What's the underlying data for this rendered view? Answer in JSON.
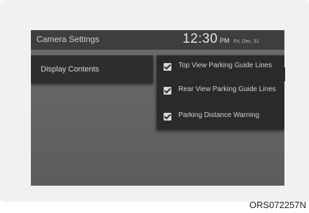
{
  "header": {
    "title": "Camera Settings",
    "time": "12:30",
    "ampm": "PM",
    "date": "Fri, Dec. 31"
  },
  "menu": {
    "selected_item": "Display Contents"
  },
  "options": [
    {
      "label": "Top View Parking Guide Lines",
      "checked": true
    },
    {
      "label": "Rear View Parking Guide Lines",
      "checked": true
    },
    {
      "label": "Parking Distance Warning",
      "checked": true
    }
  ],
  "figure_code": "ORS072257N"
}
